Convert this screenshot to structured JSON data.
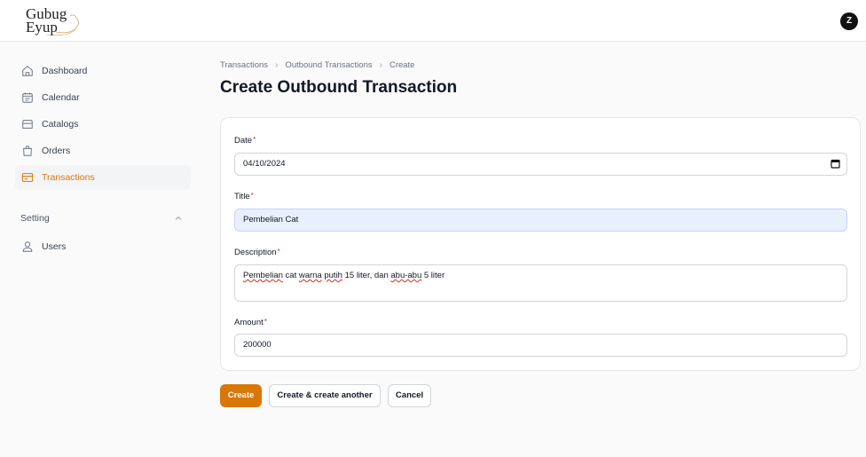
{
  "brand": {
    "logo_text": "Gubug\nEyup"
  },
  "user": {
    "avatar_initial": "Z"
  },
  "sidebar": {
    "items": [
      {
        "label": "Dashboard",
        "icon": "home-icon"
      },
      {
        "label": "Calendar",
        "icon": "calendar-icon"
      },
      {
        "label": "Catalogs",
        "icon": "folder-icon"
      },
      {
        "label": "Orders",
        "icon": "shopping-bag-icon"
      },
      {
        "label": "Transactions",
        "icon": "credit-card-icon",
        "active": true
      }
    ],
    "group_label": "Setting",
    "group_items": [
      {
        "label": "Users",
        "icon": "user-icon"
      }
    ]
  },
  "breadcrumb": [
    "Transactions",
    "Outbound Transactions",
    "Create"
  ],
  "page": {
    "title": "Create Outbound Transaction"
  },
  "form": {
    "date": {
      "label": "Date",
      "value": "04/10/2024"
    },
    "title": {
      "label": "Title",
      "value": "Pembelian Cat"
    },
    "description": {
      "label": "Description",
      "value_parts": [
        "Pembelian",
        " cat ",
        "warna",
        " ",
        "putih",
        " 15 liter, dan ",
        "abu-abu",
        " 5 liter"
      ]
    },
    "amount": {
      "label": "Amount",
      "value": "200000"
    },
    "required_marker": "*"
  },
  "actions": {
    "create": "Create",
    "create_another": "Create & create another",
    "cancel": "Cancel"
  },
  "colors": {
    "accent": "#d97706",
    "required": "#dc2626",
    "autofill": "#e8f0fe"
  }
}
